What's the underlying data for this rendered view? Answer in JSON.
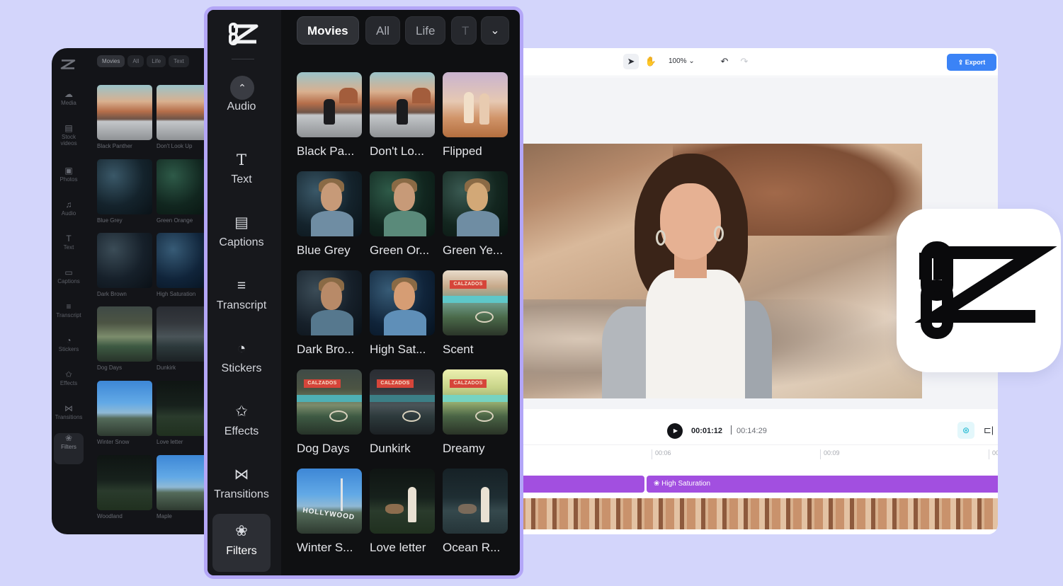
{
  "background_panel": {
    "tabs": [
      "Movies",
      "All",
      "Life",
      "Text"
    ],
    "rail_items": [
      {
        "label": "Media",
        "icon": "cloud-upload-icon"
      },
      {
        "label": "Stock videos",
        "icon": "film-icon"
      },
      {
        "label": "Photos",
        "icon": "image-icon"
      },
      {
        "label": "Audio",
        "icon": "music-note-icon"
      },
      {
        "label": "Text",
        "icon": "text-icon"
      },
      {
        "label": "Captions",
        "icon": "captions-icon"
      },
      {
        "label": "Transcript",
        "icon": "transcript-icon"
      },
      {
        "label": "Stickers",
        "icon": "sticker-icon"
      },
      {
        "label": "Effects",
        "icon": "sparkle-icon"
      },
      {
        "label": "Transitions",
        "icon": "transition-icon"
      },
      {
        "label": "Filters",
        "icon": "filters-icon"
      }
    ],
    "cards": [
      "Black Panther",
      "Don't Look Up",
      "Blue Grey",
      "Green Orange",
      "Dark Brown",
      "High Saturation",
      "Dog Days",
      "Dunkirk",
      "Winter Snow",
      "Love letter",
      "Woodland",
      "Maple"
    ]
  },
  "sidebar": {
    "items": [
      {
        "label": "Audio",
        "icon": "music-note-icon"
      },
      {
        "label": "Text",
        "icon": "text-icon"
      },
      {
        "label": "Captions",
        "icon": "captions-icon"
      },
      {
        "label": "Transcript",
        "icon": "transcript-icon"
      },
      {
        "label": "Stickers",
        "icon": "sticker-icon"
      },
      {
        "label": "Effects",
        "icon": "sparkle-icon"
      },
      {
        "label": "Transitions",
        "icon": "transition-icon"
      },
      {
        "label": "Filters",
        "icon": "filters-icon"
      }
    ],
    "active": "Filters"
  },
  "filter_tabs": [
    "Movies",
    "All",
    "Life",
    "T"
  ],
  "active_filter_tab": "Movies",
  "filters": [
    {
      "label": "Black Pa...",
      "art": "road"
    },
    {
      "label": "Don't Lo...",
      "art": "road"
    },
    {
      "label": "Flipped",
      "art": "flip"
    },
    {
      "label": "Blue Grey",
      "art": "port"
    },
    {
      "label": "Green Or...",
      "art": "port green"
    },
    {
      "label": "Green Ye...",
      "art": "port yellow"
    },
    {
      "label": "Dark Bro...",
      "art": "port brown"
    },
    {
      "label": "High Sat...",
      "art": "port hs"
    },
    {
      "label": "Scent",
      "art": "store scent"
    },
    {
      "label": "Dog Days",
      "art": "store dog"
    },
    {
      "label": "Dunkirk",
      "art": "store dunkirk"
    },
    {
      "label": "Dreamy",
      "art": "store dreamy"
    },
    {
      "label": "Winter S...",
      "art": "holly"
    },
    {
      "label": "Love letter",
      "art": "field"
    },
    {
      "label": "Ocean R...",
      "art": "field ocean"
    }
  ],
  "store_sign_text": "CALZADOS",
  "hollywood_text": "HOLLYWOOD",
  "editor": {
    "zoom": "100%",
    "export_label": "Export",
    "current_time": "00:01:12",
    "total_time": "00:14:29",
    "ruler_ticks": [
      "00:06",
      "00:09",
      "00"
    ],
    "filter_track_label": "High Saturation"
  },
  "colors": {
    "background": "#d3d5fb",
    "panel_border": "#b3a6f7",
    "filter_track": "#a24fe0",
    "export_button": "#3b83f6"
  }
}
